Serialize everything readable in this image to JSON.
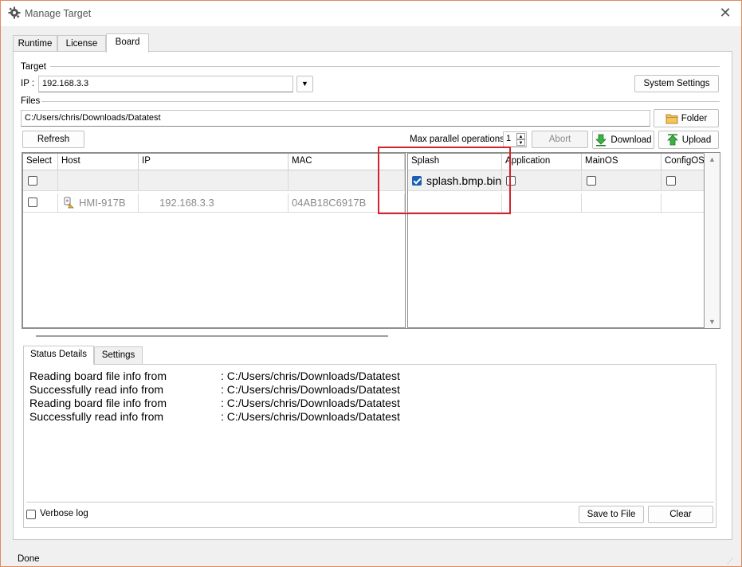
{
  "window": {
    "title": "Manage Target"
  },
  "tabs": [
    {
      "label": "Runtime"
    },
    {
      "label": "License"
    },
    {
      "label": "Board"
    }
  ],
  "target": {
    "group_label": "Target",
    "ip_label": "IP :",
    "ip_value": "192.168.3.3",
    "system_settings_label": "System Settings"
  },
  "files": {
    "group_label": "Files",
    "path_value": "C:/Users/chris/Downloads/Datatest",
    "folder_label": "Folder"
  },
  "actions": {
    "refresh_label": "Refresh",
    "max_parallel_label": "Max parallel operations:",
    "max_parallel_value": "1",
    "abort_label": "Abort",
    "download_label": "Download",
    "upload_label": "Upload"
  },
  "left_table": {
    "columns": [
      "Select",
      "Host",
      "IP",
      "MAC"
    ],
    "rows": [
      {
        "host": "HMI-917B",
        "ip": "192.168.3.3",
        "mac": "04AB18C6917B",
        "selected": false
      }
    ]
  },
  "right_table": {
    "columns": [
      "Splash",
      "Application",
      "MainOS",
      "ConfigOS"
    ],
    "filter_row": {
      "splash_checked": true,
      "splash_file": "splash.bmp.bin",
      "application_checked": false,
      "mainos_checked": false,
      "configos_checked": false
    }
  },
  "bottom_tabs": [
    {
      "label": "Status Details"
    },
    {
      "label": "Settings"
    }
  ],
  "status_lines": [
    {
      "message": "Reading board file info from",
      "path": ": C:/Users/chris/Downloads/Datatest"
    },
    {
      "message": "Successfully read info from",
      "path": ": C:/Users/chris/Downloads/Datatest"
    },
    {
      "message": "Reading board file info from",
      "path": ": C:/Users/chris/Downloads/Datatest"
    },
    {
      "message": "Successfully read info from",
      "path": ": C:/Users/chris/Downloads/Datatest"
    }
  ],
  "bottom": {
    "verbose_label": "Verbose log",
    "verbose_checked": false,
    "save_label": "Save to File",
    "clear_label": "Clear"
  },
  "statusbar": {
    "text": "Done"
  },
  "colors": {
    "highlight": "#d2242a",
    "checkbox_checked": "#1b5fb4",
    "download_green": "#2f9e2f"
  },
  "icons": [
    "gear-icon",
    "close-icon",
    "folder-icon",
    "download-arrow-icon",
    "upload-arrow-icon",
    "chevron-down-icon",
    "device-icon",
    "spin-up-icon",
    "spin-down-icon",
    "scroll-up-icon",
    "scroll-down-icon",
    "resize-grip-icon"
  ]
}
